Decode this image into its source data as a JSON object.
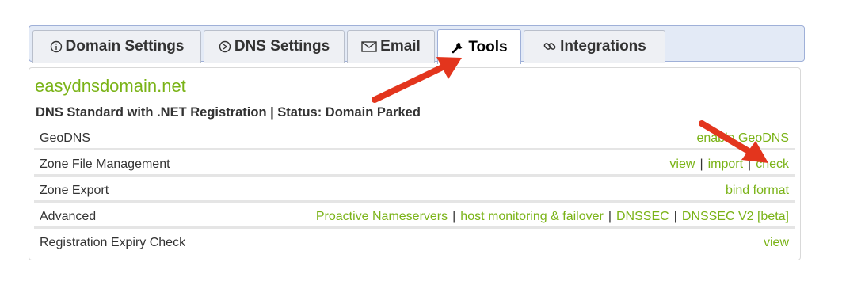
{
  "tabs": [
    {
      "label": "Domain Settings",
      "icon": "info-icon"
    },
    {
      "label": "DNS Settings",
      "icon": "dns-icon"
    },
    {
      "label": "Email",
      "icon": "envelope-icon"
    },
    {
      "label": "Tools",
      "icon": "wrench-icon",
      "active": true
    },
    {
      "label": "Integrations",
      "icon": "link-icon"
    }
  ],
  "domain": "easydnsdomain.net",
  "plan_status": "DNS Standard with .NET Registration | Status: Domain Parked",
  "rows": [
    {
      "label": "GeoDNS",
      "links": [
        "enable GeoDNS"
      ]
    },
    {
      "label": "Zone File Management",
      "links": [
        "view",
        "import",
        "check"
      ]
    },
    {
      "label": "Zone Export",
      "links": [
        "bind format"
      ]
    },
    {
      "label": "Advanced",
      "links": [
        "Proactive Nameservers",
        "host monitoring & failover",
        "DNSSEC",
        "DNSSEC V2 [beta]"
      ]
    },
    {
      "label": "Registration Expiry Check",
      "links": [
        "view"
      ]
    }
  ],
  "colors": {
    "link": "#7ab317",
    "arrow": "#e3351d",
    "tab_bar": "#e3eaf6"
  }
}
